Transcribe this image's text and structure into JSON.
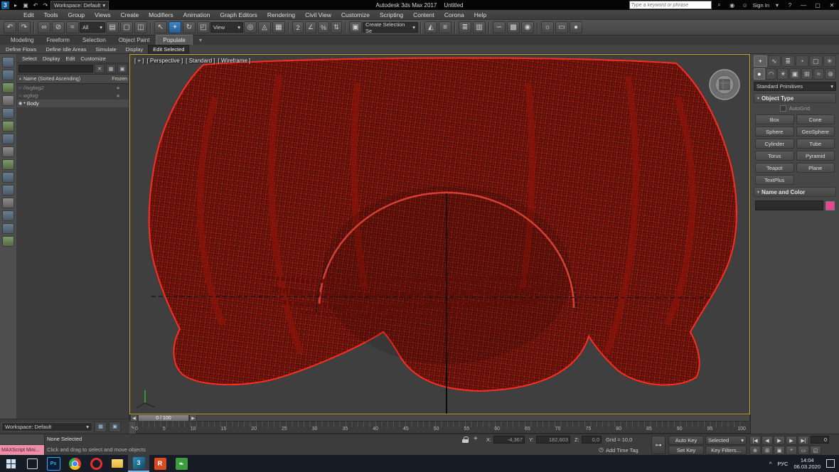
{
  "titlebar": {
    "app_title": "Autodesk 3ds Max 2017",
    "doc_title": "Untitled",
    "workspace": "Workspace: Default",
    "search_placeholder": "Type a keyword or phrase",
    "sign_in": "Sign In"
  },
  "menubar": {
    "items": [
      "Edit",
      "Tools",
      "Group",
      "Views",
      "Create",
      "Modifiers",
      "Animation",
      "Graph Editors",
      "Rendering",
      "Civil View",
      "Customize",
      "Scripting",
      "Content",
      "Corona",
      "Help"
    ]
  },
  "toolbar": {
    "filter": "All",
    "refcoord": "View",
    "selection_set": "Create Selection Se"
  },
  "ribbon": {
    "tabs": [
      "Modeling",
      "Freeform",
      "Selection",
      "Object Paint",
      "Populate"
    ],
    "tools": [
      "Define Flows",
      "Define Idle Areas",
      "Simulate",
      "Display",
      "Edit Selected"
    ]
  },
  "explorer": {
    "menu": [
      "Select",
      "Display",
      "Edit",
      "Customize"
    ],
    "search_placeholder": "",
    "name_header": "Name (Sorted Ascending)",
    "frozen_header": "Frozen",
    "rows": [
      {
        "name": "//wglwg2"
      },
      {
        "name": "wglwg"
      },
      {
        "name": "Body"
      }
    ]
  },
  "viewport": {
    "general_label": "[ + ]",
    "pov_label": "[ Perspective ]",
    "shading_label": "[ Standard ]",
    "style_label": "[ Wireframe ]"
  },
  "cmd": {
    "category": "Standard Primitives",
    "object_type": "Object Type",
    "autogrid": "AutoGrid",
    "buttons": [
      "Box",
      "Cone",
      "Sphere",
      "GeoSphere",
      "Cylinder",
      "Tube",
      "Torus",
      "Pyramid",
      "Teapot",
      "Plane",
      "TextPlus"
    ],
    "name_color": "Name and Color"
  },
  "timeline": {
    "handle": "0 / 100",
    "ticks": [
      "0",
      "5",
      "10",
      "15",
      "20",
      "25",
      "30",
      "35",
      "40",
      "45",
      "50",
      "55",
      "60",
      "65",
      "70",
      "75",
      "80",
      "85",
      "90",
      "95",
      "100"
    ]
  },
  "status": {
    "maxscript": "MAXScript Mini...",
    "selection": "None Selected",
    "prompt": "Click and drag to select and move objects",
    "x_label": "X:",
    "y_label": "Y:",
    "z_label": "Z:",
    "x_value": "-4,367",
    "y_value": "182,603",
    "z_value": "0,0",
    "grid": "Grid = 10,0",
    "add_time_tag": "Add Time Tag",
    "auto_key": "Auto Key",
    "selected": "Selected",
    "set_key": "Set Key",
    "key_filters": "Key Filters...",
    "frame": "0",
    "workspace": "Workspace: Default"
  },
  "taskbar": {
    "lang": "РУС",
    "time": "14:04",
    "date": "06.03.2020"
  },
  "icons": {
    "flyout": "▸",
    "dd": "▾",
    "save": "▣",
    "undo": "↶",
    "redo": "↷",
    "link": "∞",
    "unlink": "⊘",
    "bind": "≈",
    "sel_by_name": "▤",
    "region": "▢",
    "win_cross": "◫",
    "select": "↖",
    "move": "+",
    "rotate": "↻",
    "scale": "◰",
    "pivot": "◎",
    "manipulate": "◬",
    "keyboard": "▦",
    "snap": "2",
    "angle_snap": "∠",
    "percent_snap": "%",
    "spinner_snap": "⇅",
    "named_sets": "▣",
    "mirror": "◭",
    "align": "≡",
    "layers": "≣",
    "ribbon_toggle": "▥",
    "curve_editor": "∽",
    "schematic": "▩",
    "material_editor": "◉",
    "render_setup": "☼",
    "render_frame": "▭",
    "render": "●",
    "sort_asc": "▲",
    "frozen_mark": "∗",
    "eye": "◉",
    "body_dot": "•",
    "clear": "✕",
    "columns": "▦",
    "lock_sel": "▣",
    "left_arrow": "◀",
    "right_arrow": "▶",
    "go_start": "|◀",
    "prev_frame": "◀",
    "play": "▶",
    "next_frame": "▶",
    "go_end": "▶|",
    "zoom": "⊕",
    "zoom_all": "⊞",
    "zoom_extents": "▣",
    "pan": "+",
    "zoom_region": "▭",
    "max_viewport": "◱",
    "clock": "◷",
    "set_keys": "⊶",
    "transform": "+",
    "cp_create": "+",
    "cp_modify": "∿",
    "cp_hierarchy": "≣",
    "cp_motion": "◔",
    "cp_display": "▢",
    "cp_utilities": "✳",
    "cat_geometry": "●",
    "cat_shapes": "◠",
    "cat_lights": "☀",
    "cat_cameras": "▣",
    "cat_helpers": "⊞",
    "cat_spacewarps": "≈",
    "cat_systems": "⊛",
    "min": "—",
    "max": "▢",
    "close": "✕",
    "help": "?",
    "person": "☺",
    "tray_up": "^",
    "info": "◉",
    "mce": "∿",
    "ws_btn1": "▦",
    "ws_btn2": "▣"
  }
}
